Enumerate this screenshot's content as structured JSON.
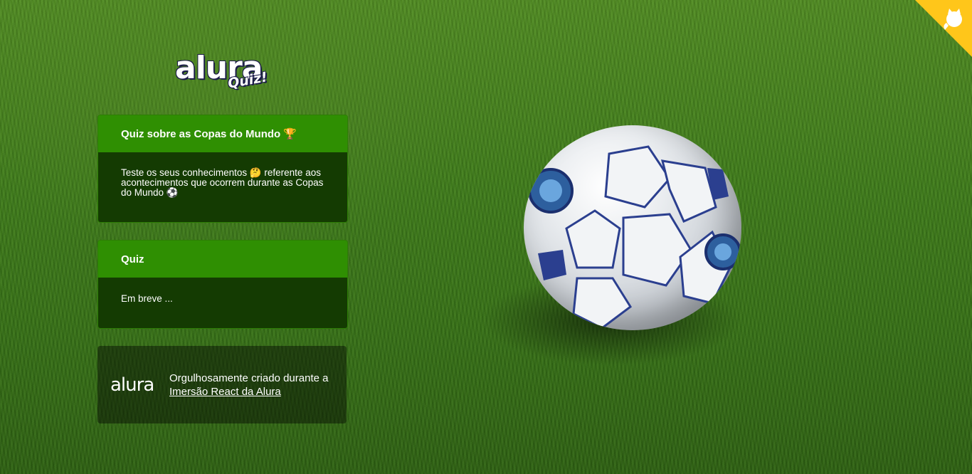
{
  "logo": {
    "main": "alura",
    "sub": "Quiz!"
  },
  "intro_widget": {
    "title": "Quiz sobre as Copas do Mundo 🏆",
    "description": "Teste os seus conhecimentos 🤔 referente aos acontecimentos que ocorrem durante as Copas do Mundo ⚽"
  },
  "quiz_widget": {
    "title": "Quiz",
    "body": "Em breve ..."
  },
  "footer": {
    "logo_text": "alura",
    "text_prefix": "Orgulhosamente criado durante a ",
    "link_label": "Imersão React da Alura"
  },
  "corner": {
    "icon": "github-octocat-icon",
    "color": "#ffc61a"
  },
  "colors": {
    "primary": "#2f8f02",
    "widget_body": "#143b02"
  }
}
